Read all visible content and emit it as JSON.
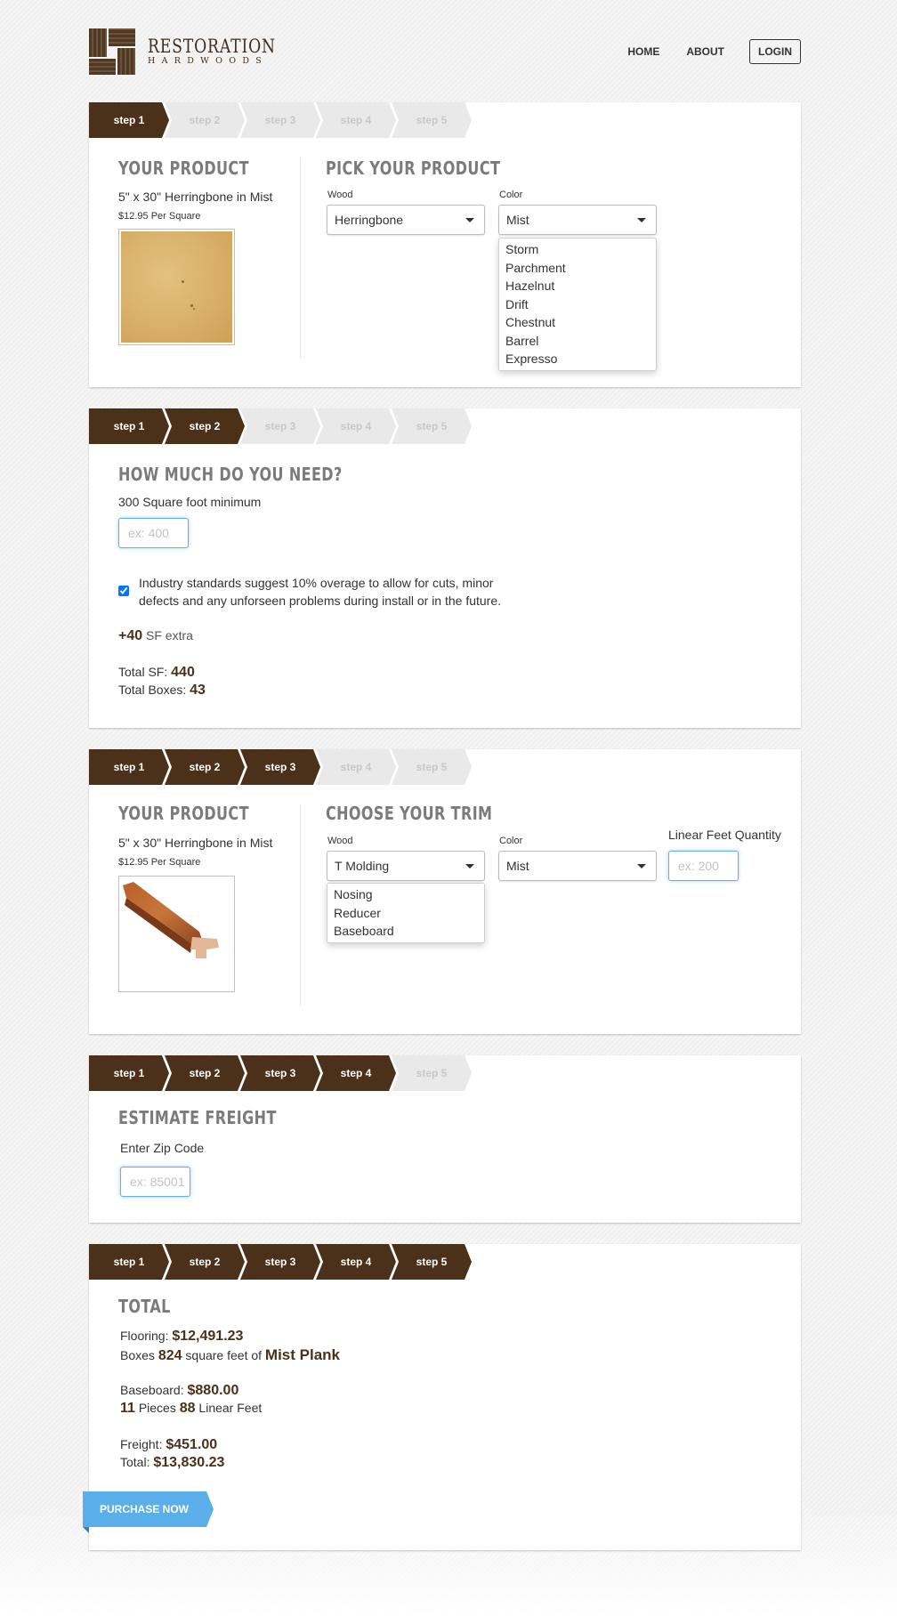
{
  "brand": {
    "title": "RESTORATION",
    "subtitle": "HARDWOODS"
  },
  "nav": {
    "home": "HOME",
    "about": "ABOUT",
    "login": "LOGIN"
  },
  "steps": [
    "step 1",
    "step 2",
    "step 3",
    "step 4",
    "step 5"
  ],
  "section1": {
    "your_product_title": "YOUR PRODUCT",
    "product_name": "5\" x 30\" Herringbone in Mist",
    "product_price": "$12.95 Per Square",
    "pick_title": "PICK YOUR PRODUCT",
    "wood_label": "Wood",
    "wood_value": "Herringbone",
    "color_label": "Color",
    "color_value": "Mist",
    "color_options": [
      "Storm",
      "Parchment",
      "Hazelnut",
      "Drift",
      "Chestnut",
      "Barrel",
      "Expresso"
    ]
  },
  "section2": {
    "title": "HOW MUCH DO YOU NEED?",
    "minimum": "300 Square foot minimum",
    "placeholder": "ex: 400",
    "overage_text_1": "Industry standards suggest 10% overage to allow for cuts, minor",
    "overage_text_2": "defects and any unforseen problems during install or in the future.",
    "overage_checked": true,
    "extra_value": "+40",
    "extra_label": "SF extra",
    "total_sf_label": "Total SF:",
    "total_sf": "440",
    "total_boxes_label": "Total Boxes:",
    "total_boxes": "43"
  },
  "section3": {
    "your_product_title": "YOUR PRODUCT",
    "product_name": "5\" x 30\" Herringbone in Mist",
    "product_price": "$12.95 Per Square",
    "trim_title": "CHOOSE YOUR TRIM",
    "wood_label": "Wood",
    "wood_value": "T Molding",
    "wood_options": [
      "Nosing",
      "Reducer",
      "Baseboard"
    ],
    "color_label": "Color",
    "color_value": "Mist",
    "linear_label": "Linear Feet Quantity",
    "linear_placeholder": "ex: 200"
  },
  "section4": {
    "title": "ESTIMATE FREIGHT",
    "zip_label": "Enter Zip Code",
    "zip_placeholder": "ex: 85001"
  },
  "section5": {
    "title": "TOTAL",
    "flooring_label": "Flooring:",
    "flooring_value": "$12,491.23",
    "boxes_label": "Boxes",
    "boxes_value": "824",
    "sqft_label": "square feet of",
    "product_value": "Mist Plank",
    "baseboard_label": "Baseboard:",
    "baseboard_value": "$880.00",
    "pieces_value": "11",
    "pieces_label": "Pieces",
    "linear_value": "88",
    "linear_label": "Linear Feet",
    "freight_label": "Freight:",
    "freight_value": "$451.00",
    "total_label": "Total:",
    "total_value": "$13,830.23",
    "purchase": "PURCHASE NOW"
  },
  "colors": {
    "brown": "#4b3119",
    "step_off": "#e9e9e9",
    "purchase_blue": "#5aaeea",
    "focus_blue": "#66afe9"
  }
}
